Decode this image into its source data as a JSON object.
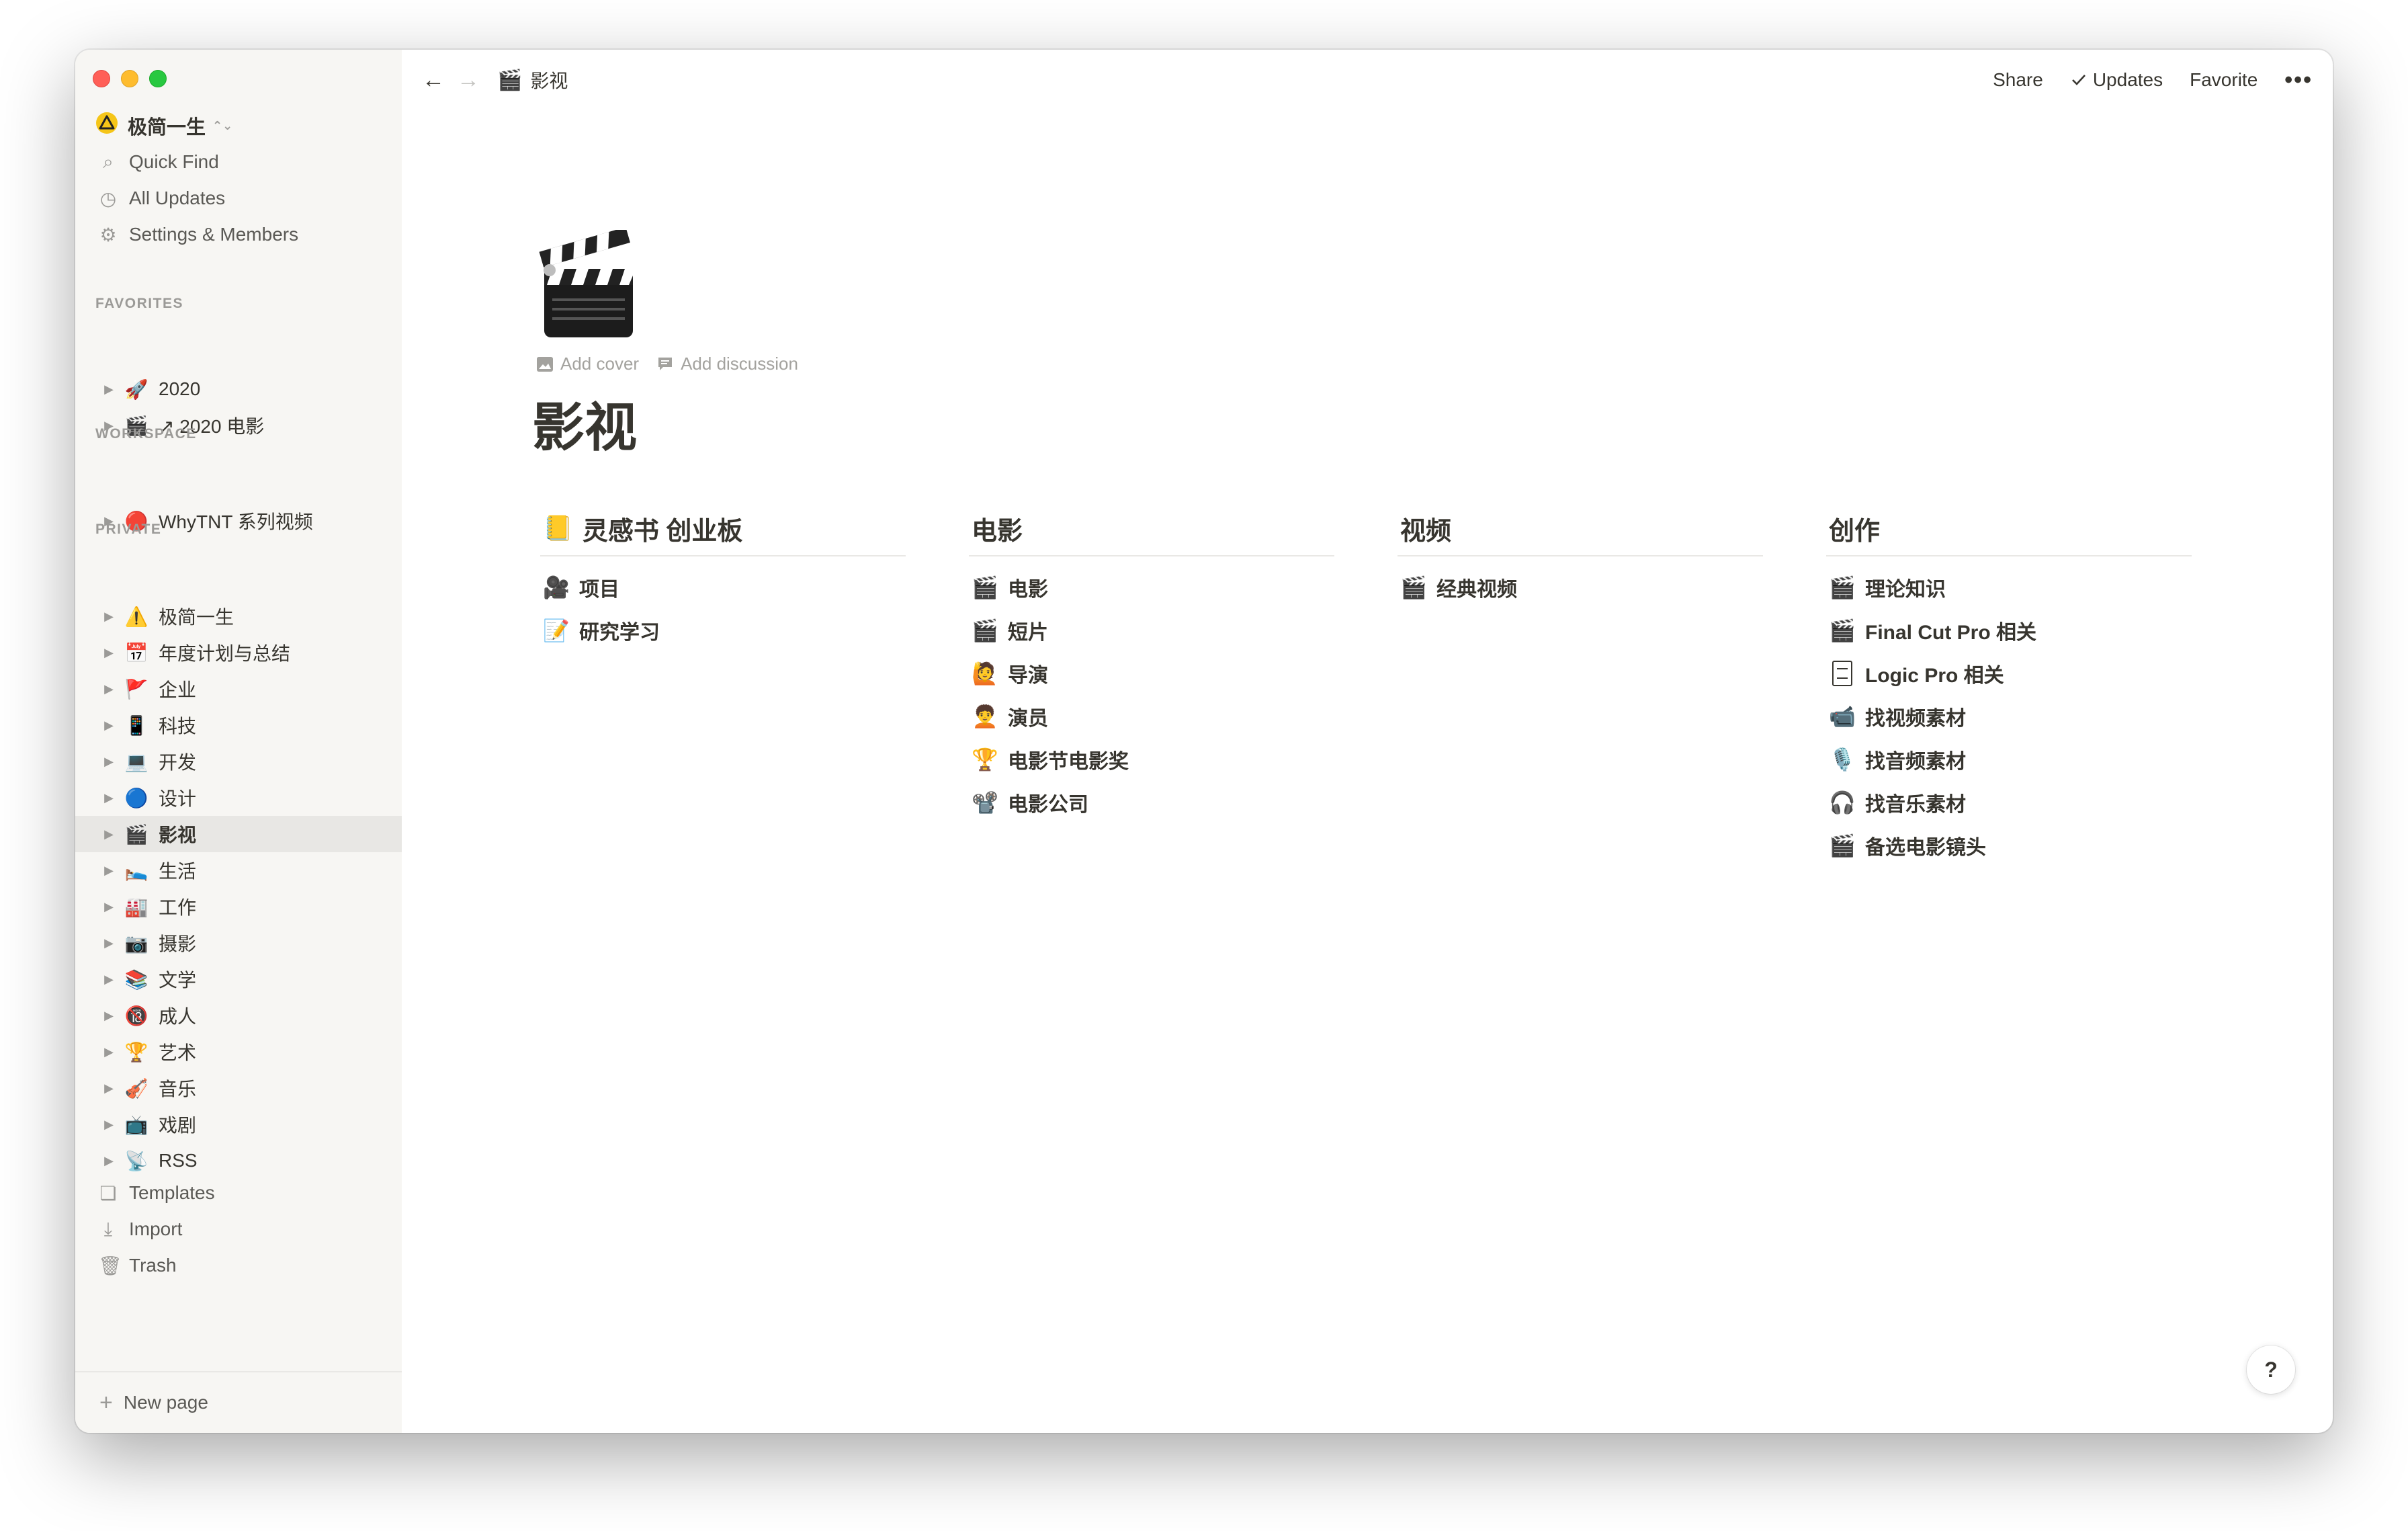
{
  "workspace": {
    "name": "极简一生",
    "logo": "warning-icon",
    "switcher": "⌃⌄"
  },
  "sidebar": {
    "utilities": [
      {
        "label": "Quick Find",
        "icon": "search-icon"
      },
      {
        "label": "All Updates",
        "icon": "clock-icon"
      },
      {
        "label": "Settings & Members",
        "icon": "gear-icon"
      }
    ],
    "favorites_title": "FAVORITES",
    "favorites": [
      {
        "emoji": "🚀",
        "label": "2020"
      },
      {
        "emoji": "🎬",
        "label": "↗ 2020 电影"
      }
    ],
    "workspace_title": "WORKSPACE",
    "workspace_items": [
      {
        "emoji": "🔴",
        "label": "WhyTNT 系列视频"
      }
    ],
    "private_title": "PRIVATE",
    "private": [
      {
        "emoji": "⚠️",
        "label": "极简一生"
      },
      {
        "emoji": "📅",
        "label": "年度计划与总结"
      },
      {
        "emoji": "🚩",
        "label": "企业"
      },
      {
        "emoji": "📱",
        "label": "科技"
      },
      {
        "emoji": "💻",
        "label": "开发"
      },
      {
        "emoji": "🔵",
        "label": "设计"
      },
      {
        "emoji": "🎬",
        "label": "影视"
      },
      {
        "emoji": "🛌",
        "label": "生活"
      },
      {
        "emoji": "🏭",
        "label": "工作"
      },
      {
        "emoji": "📷",
        "label": "摄影"
      },
      {
        "emoji": "📚",
        "label": "文学"
      },
      {
        "emoji": "🔞",
        "label": "成人"
      },
      {
        "emoji": "🏆",
        "label": "艺术"
      },
      {
        "emoji": "🎻",
        "label": "音乐"
      },
      {
        "emoji": "📺",
        "label": "戏剧"
      },
      {
        "emoji": "📡",
        "label": "RSS"
      }
    ],
    "active_index": 6,
    "bottom": [
      {
        "label": "Templates",
        "icon": "templates-icon"
      },
      {
        "label": "Import",
        "icon": "import-icon"
      },
      {
        "label": "Trash",
        "icon": "trash-icon"
      }
    ],
    "new_page": "New page"
  },
  "topbar": {
    "back": "←",
    "forward": "→",
    "breadcrumb_emoji": "🎬",
    "breadcrumb": "影视",
    "share": "Share",
    "updates": "Updates",
    "favorite": "Favorite",
    "more": "•••"
  },
  "page": {
    "icon": "clapperboard-icon",
    "add_cover": "Add cover",
    "add_discussion": "Add discussion",
    "title": "影视"
  },
  "columns": [
    {
      "emoji": "📒",
      "heading": "灵感书 创业板",
      "items": [
        {
          "emoji": "🎥",
          "label": "项目"
        },
        {
          "emoji": "📝",
          "label": "研究学习"
        }
      ]
    },
    {
      "emoji": "",
      "heading": "电影",
      "items": [
        {
          "emoji": "🎬",
          "label": "电影"
        },
        {
          "emoji": "🎬",
          "label": "短片"
        },
        {
          "emoji": "🙋",
          "label": "导演"
        },
        {
          "emoji": "🧑‍🦱",
          "label": "演员"
        },
        {
          "emoji": "🏆",
          "label": "电影节电影奖"
        },
        {
          "emoji": "📽️",
          "label": "电影公司"
        }
      ]
    },
    {
      "emoji": "",
      "heading": "视频",
      "items": [
        {
          "emoji": "🎬",
          "label": "经典视频"
        }
      ]
    },
    {
      "emoji": "",
      "heading": "创作",
      "items": [
        {
          "emoji": "🎬",
          "label": "理论知识"
        },
        {
          "emoji": "🎬",
          "label": "Final Cut Pro 相关"
        },
        {
          "emoji": "doc",
          "label": "Logic Pro 相关"
        },
        {
          "emoji": "📹",
          "label": "找视频素材"
        },
        {
          "emoji": "🎙️",
          "label": "找音频素材"
        },
        {
          "emoji": "🎧",
          "label": "找音乐素材"
        },
        {
          "emoji": "🎬",
          "label": "备选电影镜头"
        }
      ]
    }
  ],
  "help": "?"
}
